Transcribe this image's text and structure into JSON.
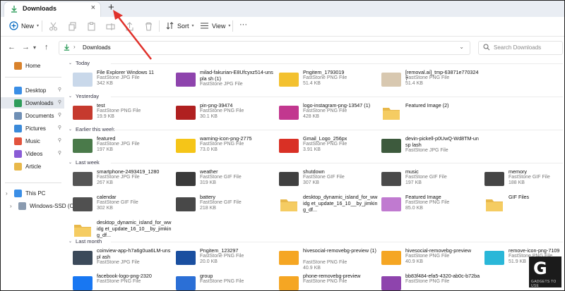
{
  "tab": {
    "title": "Downloads",
    "close": "×",
    "new_tab": "+"
  },
  "toolbar": {
    "new": "New",
    "sort": "Sort",
    "view": "View",
    "more": "···"
  },
  "address": {
    "back": "←",
    "forward": "→",
    "up": "↑",
    "path": "Downloads",
    "search_placeholder": "Search Downloads"
  },
  "sidebar": {
    "items": [
      {
        "label": "Home",
        "icon": "home-icon",
        "color": "#d9822b"
      },
      {
        "label": "Desktop",
        "icon": "desktop-folder-icon",
        "color": "#3a8ee6",
        "pinned": true
      },
      {
        "label": "Downloads",
        "icon": "downloads-folder-icon",
        "color": "#2e9c5a",
        "pinned": true,
        "selected": true
      },
      {
        "label": "Documents",
        "icon": "documents-folder-icon",
        "color": "#6f8fb5",
        "pinned": true
      },
      {
        "label": "Pictures",
        "icon": "pictures-folder-icon",
        "color": "#3b8ad9",
        "pinned": true
      },
      {
        "label": "Music",
        "icon": "music-folder-icon",
        "color": "#e2533d",
        "pinned": true
      },
      {
        "label": "Videos",
        "icon": "videos-folder-icon",
        "color": "#8a5cd6",
        "pinned": true
      },
      {
        "label": "Article",
        "icon": "folder-icon",
        "color": "#e8b84a"
      },
      {
        "label": "This PC",
        "icon": "this-pc-icon",
        "color": "#3a8ee6"
      },
      {
        "label": "Windows-SSD (C:)",
        "icon": "drive-icon",
        "color": "#8a9bb0"
      }
    ]
  },
  "groups": [
    {
      "label": "Today",
      "files": [
        {
          "name": "File Explorer Windows 11",
          "type": "FastStone JPG File",
          "size": "342 KB",
          "thumb": "#c9d8ea"
        },
        {
          "name": "milad-fakurian-E8Ufcyxz514-unspla sh (1)",
          "type": "FastStone JPG File",
          "size": "",
          "thumb": "#8e44ad"
        },
        {
          "name": "Pngitem_1793019",
          "type": "FastStone PNG File",
          "size": "51.4 KB",
          "thumb": "#f3c12f"
        },
        {
          "name": "[removal.ai]_tmp-63871e7703247",
          "type": "FastStone PNG File",
          "size": "51.4 KB",
          "thumb": "#d8c8b0"
        }
      ]
    },
    {
      "label": "Yesterday",
      "files": [
        {
          "name": "test",
          "type": "FastStone PNG File",
          "size": "19.9 KB",
          "thumb": "#c63a2e"
        },
        {
          "name": "pin-png-39474",
          "type": "FastStone PNG File",
          "size": "30.1 KB",
          "thumb": "#b02020"
        },
        {
          "name": "logo-instagram-png-13547 (1)",
          "type": "FastStone PNG File",
          "size": "428 KB",
          "thumb": "#c2378f"
        },
        {
          "name": "Featured Image (2)",
          "type": "",
          "size": "",
          "thumb": "#e8b84a"
        }
      ]
    },
    {
      "label": "Earlier this week",
      "files": [
        {
          "name": "featured",
          "type": "FastStone JPG File",
          "size": "197 KB",
          "thumb": "#4a7a4a"
        },
        {
          "name": "warning-icon-png-2775",
          "type": "FastStone PNG File",
          "size": "73.0 KB",
          "thumb": "#f5c518"
        },
        {
          "name": "Gmail_Logo_256px",
          "type": "FastStone PNG File",
          "size": "3.91 KB",
          "thumb": "#d93025"
        },
        {
          "name": "devin-pickell-p0UwQ-Wd8TM-unsp lash",
          "type": "FastStone JPG File",
          "size": "",
          "thumb": "#3d5a3d"
        }
      ]
    },
    {
      "label": "Last week",
      "files": [
        {
          "name": "smartphone-2493419_1280",
          "type": "FastStone JPG File",
          "size": "267 KB",
          "thumb": "#555555"
        },
        {
          "name": "weather",
          "type": "FastStone GIF File",
          "size": "319 KB",
          "thumb": "#3a3a3a"
        },
        {
          "name": "shutdown",
          "type": "FastStone GIF File",
          "size": "307 KB",
          "thumb": "#404040"
        },
        {
          "name": "music",
          "type": "FastStone GIF File",
          "size": "197 KB",
          "thumb": "#4a4a4a"
        },
        {
          "name": "memory",
          "type": "FastStone GIF File",
          "size": "188 KB",
          "thumb": "#454545"
        },
        {
          "name": "calendar",
          "type": "FastStone GIF File",
          "size": "302 KB",
          "thumb": "#505050"
        },
        {
          "name": "battery",
          "type": "FastStone GIF File",
          "size": "218 KB",
          "thumb": "#484848"
        },
        {
          "name": "desktop_dynamic_island_for_wwidg et_update_16_10__by_jimking_df...",
          "type": "",
          "size": "",
          "thumb": "#e8b84a"
        },
        {
          "name": "Featured Image",
          "type": "FastStone PNG File",
          "size": "85.0 KB",
          "thumb": "#c07ad0"
        },
        {
          "name": "GIF Files",
          "type": "",
          "size": "",
          "thumb": "#e8b84a"
        },
        {
          "name": "desktop_dynamic_island_for_wwidg et_update_16_10__by_jimking_df...",
          "type": "",
          "size": "",
          "thumb": "#e8b84a"
        }
      ]
    },
    {
      "label": "Last month",
      "files": [
        {
          "name": "coinview-app-h7a6g0ua6LM-unspl ash",
          "type": "FastStone JPG File",
          "size": "",
          "thumb": "#3c4a5a"
        },
        {
          "name": "Pngitem_123297",
          "type": "FastStone PNG File",
          "size": "20.0 KB",
          "thumb": "#1a4fa0"
        },
        {
          "name": "hivesocial-removebg-preview (1)",
          "type": "FastStone PNG File",
          "size": "40.9 KB",
          "thumb": "#f5a623"
        },
        {
          "name": "hivesocial-removebg-preview",
          "type": "FastStone PNG File",
          "size": "40.9 KB",
          "thumb": "#f5a623"
        },
        {
          "name": "remove-icon-png-7109",
          "type": "FastStone PNG File",
          "size": "51.9 KB",
          "thumb": "#2ab7d8"
        },
        {
          "name": "facebook-logo-png-2320",
          "type": "FastStone PNG File",
          "size": "",
          "thumb": "#1877f2"
        },
        {
          "name": "group",
          "type": "FastStone PNG File",
          "size": "",
          "thumb": "#2b6fd6"
        },
        {
          "name": "phone-removebg-preview",
          "type": "FastStone PNG File",
          "size": "",
          "thumb": "#f5a623"
        },
        {
          "name": "bb83f484-efa5-4320-ab0c-b72ba",
          "type": "FastStone PNG File",
          "size": "",
          "thumb": "#8e44ad"
        }
      ]
    }
  ],
  "watermark": {
    "mark": "G",
    "text": "GADGETS TO USE"
  },
  "colors": {
    "accent": "#0067c0",
    "arrow": "#e0312b"
  }
}
